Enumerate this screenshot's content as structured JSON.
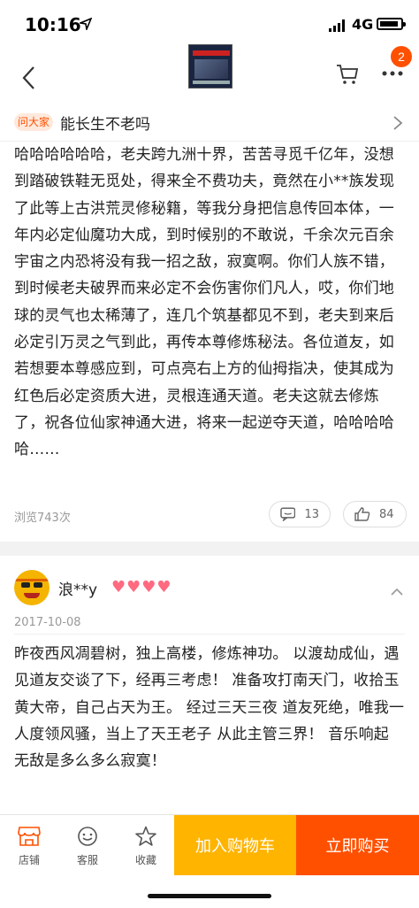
{
  "status_bar": {
    "time": "10:16",
    "network": "4G"
  },
  "nav": {
    "cart_badge": "2",
    "icons": [
      "back-icon",
      "cart-icon",
      "more-icon"
    ]
  },
  "question": {
    "tag": "问大家",
    "text": "能长生不老吗"
  },
  "answers": [
    {
      "body": "哈哈哈哈哈哈，老夫跨九洲十界，苦苦寻觅千亿年，没想到踏破铁鞋无觅处，得来全不费功夫，竟然在小**族发现了此等上古洪荒灵修秘籍，等我分身把信息传回本体，一年内必定仙魔功大成，到时候别的不敢说，千余次元百余宇宙之内恐将没有我一招之敌，寂寞啊。你们人族不错，到时候老夫破界而来必定不会伤害你们凡人，哎，你们地球的灵气也太稀薄了，连几个筑基都见不到，老夫到来后必定引万灵之气到此，再传本尊修炼秘法。各位道友，如若想要本尊感应到，可点亮右上方的仙拇指决，使其成为红色后必定资质大进，灵根连通天道。老夫这就去修炼了，祝各位仙家神通大进，将来一起逆夺天道，哈哈哈哈哈……",
      "views": "浏览743次",
      "comments": "13",
      "likes": "84"
    },
    {
      "username": "浪**y",
      "date": "2017-10-08",
      "body": "昨夜西风凋碧树，独上高楼，修炼神功。  以渡劫成仙，遇见道友交谈了下，经再三考虑！    准备攻打南天门，收拾玉黄大帝，自己占天为王。     经过三天三夜    道友死绝，唯我一人度领风骚，当上了天王老子  从此主管三界！     音乐响起  无敌是多么多么寂寞！"
    }
  ],
  "bottom_bar": {
    "shop_label": "店铺",
    "service_label": "客服",
    "favorite_label": "收藏",
    "add_to_cart": "加入购物车",
    "buy_now": "立即购买"
  },
  "colors": {
    "accent": "#ff5000",
    "cart_button": "#ffb400"
  }
}
